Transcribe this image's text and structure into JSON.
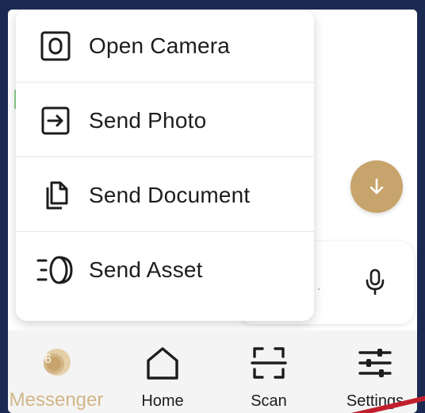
{
  "popup_menu": {
    "items": [
      {
        "label": "Open Camera",
        "icon": "camera-icon"
      },
      {
        "label": "Send Photo",
        "icon": "send-photo-icon"
      },
      {
        "label": "Send Document",
        "icon": "document-icon"
      },
      {
        "label": "Send Asset",
        "icon": "asset-icon"
      }
    ]
  },
  "composer": {
    "placeholder_fragment": ".",
    "mic_icon": "microphone-icon",
    "scroll_icon": "arrow-down-icon"
  },
  "bottom_nav": {
    "items": [
      {
        "label": "Messenger",
        "icon": "messenger-icon",
        "badge": "6",
        "active": true
      },
      {
        "label": "Home",
        "icon": "home-icon",
        "active": false
      },
      {
        "label": "Scan",
        "icon": "scan-icon",
        "active": false
      },
      {
        "label": "Settings",
        "icon": "settings-sliders-icon",
        "active": false
      }
    ]
  },
  "colors": {
    "accent_gold": "#c7a46b",
    "active_label": "#d2b688",
    "frame_bg": "#1b2a52",
    "red_mark": "#c21f2d"
  }
}
